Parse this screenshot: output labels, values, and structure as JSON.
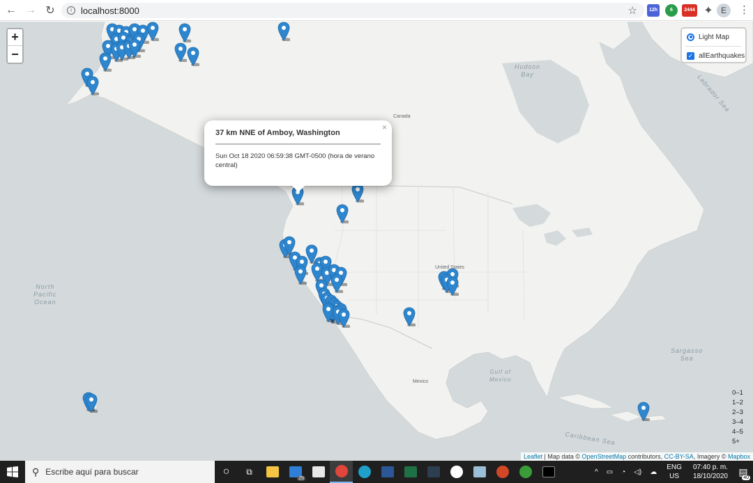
{
  "browser": {
    "url": "localhost:8000",
    "extensions": [
      {
        "name": "calendar-extension-icon",
        "label": "12h",
        "color": "#4a63d9"
      },
      {
        "name": "green-extension-icon",
        "label": "6",
        "color": "#2a9d4a"
      },
      {
        "name": "gmail-extension-icon",
        "label": "2444",
        "color": "#d93025"
      }
    ],
    "profile_initial": "E"
  },
  "map": {
    "zoom_in": "+",
    "zoom_out": "−",
    "layers": {
      "base": "Light Map",
      "overlay": "allEarthquakes"
    },
    "labels": {
      "hudson_bay": "Hudson\nBay",
      "labrador_sea": "Labrador Sea",
      "north_pacific": "North\nPacific\nOcean",
      "sargasso": "Sargasso\nSea",
      "gulf_mexico": "Gulf of\nMexico",
      "caribbean": "Caribbean Sea",
      "canada": "Canada",
      "united_states": "United States",
      "mexico": "Mexico"
    },
    "popup": {
      "title": "37 km NNE of Amboy, Washington",
      "time": "Sun Oct 18 2020 06:59:38 GMT-0500 (hora de verano central)",
      "close": "×"
    },
    "legend": [
      "0–1",
      "1–2",
      "2–3",
      "3–4",
      "4–5",
      "5+"
    ],
    "attribution": {
      "leaflet": "Leaflet",
      "text1": " | Map data © ",
      "osm": "OpenStreetMap",
      "text2": " contributors, ",
      "license": "CC-BY-SA",
      "text3": ", Imagery © ",
      "mapbox": "Mapbox"
    },
    "marker_color": "#2e86cf"
  },
  "taskbar": {
    "search_placeholder": "Escribe aquí para buscar",
    "mail_badge": "25",
    "tray_lang": "ENG",
    "tray_region": "US",
    "time": "07:40 p. m.",
    "date": "18/10/2020",
    "notifications": "40"
  }
}
